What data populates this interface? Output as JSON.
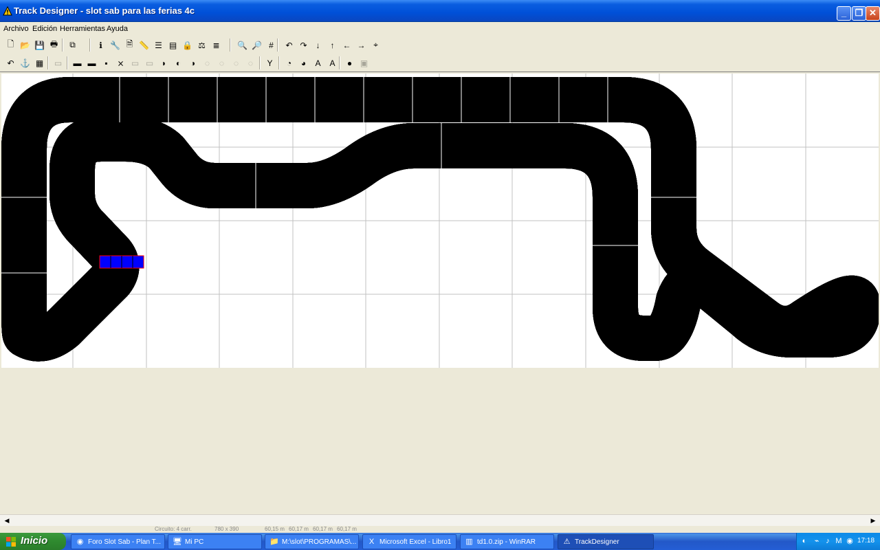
{
  "window": {
    "title": "Track Designer - slot sab para las ferias 4c",
    "minimize": "_",
    "maximize": "❐",
    "close": "✕"
  },
  "menu": [
    "Archivo",
    "Edición",
    "Herramientas",
    "Ayuda"
  ],
  "toolbar1": [
    {
      "name": "new-icon",
      "glyph": "🗋"
    },
    {
      "name": "open-icon",
      "glyph": "📂"
    },
    {
      "name": "save-icon",
      "glyph": "💾"
    },
    {
      "name": "print-icon",
      "glyph": "🖶"
    },
    {
      "name": "copy-icon",
      "glyph": "⧉"
    },
    {
      "name": "info-icon",
      "glyph": "ℹ"
    },
    {
      "name": "wrench-icon",
      "glyph": "🔧"
    },
    {
      "name": "document-icon",
      "glyph": "🗎"
    },
    {
      "name": "ruler-icon",
      "glyph": "📏"
    },
    {
      "name": "stack-icon",
      "glyph": "☰"
    },
    {
      "name": "layers-icon",
      "glyph": "▤"
    },
    {
      "name": "lock-icon",
      "glyph": "🔒"
    },
    {
      "name": "balance-icon",
      "glyph": "⚖"
    },
    {
      "name": "track-list-icon",
      "glyph": "≣"
    },
    {
      "name": "zoom-out-icon",
      "glyph": "🔍"
    },
    {
      "name": "zoom-in-icon",
      "glyph": "🔎"
    },
    {
      "name": "grid-icon",
      "glyph": "#"
    },
    {
      "name": "rotate-left-icon",
      "glyph": "↶"
    },
    {
      "name": "rotate-right-icon",
      "glyph": "↷"
    },
    {
      "name": "arrow-down-icon",
      "glyph": "↓"
    },
    {
      "name": "arrow-up-icon",
      "glyph": "↑"
    },
    {
      "name": "arrow-left-icon",
      "glyph": "←"
    },
    {
      "name": "arrow-right-icon",
      "glyph": "→"
    },
    {
      "name": "center-icon",
      "glyph": "⌖"
    }
  ],
  "toolbar2": [
    {
      "name": "undo-icon",
      "glyph": "↶",
      "enabled": true
    },
    {
      "name": "anchor-icon",
      "glyph": "⚓",
      "enabled": true
    },
    {
      "name": "track-piece-icon",
      "glyph": "▦",
      "enabled": true
    },
    {
      "name": "track-piece-disabled-icon",
      "glyph": "▭",
      "enabled": false
    },
    {
      "name": "straight-long-icon",
      "glyph": "▬",
      "enabled": true
    },
    {
      "name": "straight-medium-icon",
      "glyph": "▬",
      "enabled": true
    },
    {
      "name": "straight-short-icon",
      "glyph": "▪",
      "enabled": true
    },
    {
      "name": "crossover-icon",
      "glyph": "⨯",
      "enabled": true
    },
    {
      "name": "straight-disabled-icon",
      "glyph": "▭",
      "enabled": false
    },
    {
      "name": "straight-disabled-2-icon",
      "glyph": "▭",
      "enabled": false
    },
    {
      "name": "curve-small-icon",
      "glyph": "◗",
      "enabled": true
    },
    {
      "name": "curve-medium-icon",
      "glyph": "◐",
      "enabled": true
    },
    {
      "name": "curve-large-icon",
      "glyph": "◑",
      "enabled": true
    },
    {
      "name": "curve-disabled-icon",
      "glyph": "◌",
      "enabled": false
    },
    {
      "name": "curve-disabled-2-icon",
      "glyph": "◌",
      "enabled": false
    },
    {
      "name": "hairpin-disabled-icon",
      "glyph": "◌",
      "enabled": false
    },
    {
      "name": "loop-disabled-icon",
      "glyph": "◌",
      "enabled": false
    },
    {
      "name": "junction-icon",
      "glyph": "Y",
      "enabled": true
    },
    {
      "name": "border-icon",
      "glyph": "◔",
      "enabled": true
    },
    {
      "name": "border-curve-icon",
      "glyph": "◕",
      "enabled": true
    },
    {
      "name": "auto-icon",
      "glyph": "A",
      "enabled": true
    },
    {
      "name": "auto-remove-icon",
      "glyph": "A",
      "enabled": true
    },
    {
      "name": "color-icon",
      "glyph": "●",
      "enabled": true
    },
    {
      "name": "settings-disabled-icon",
      "glyph": "▣",
      "enabled": false
    }
  ],
  "status": [
    "Circuito: 4 carr.",
    "780 x 390",
    "60,15 m",
    "60,17 m",
    "60,17 m",
    "60,17 m"
  ],
  "taskbar": {
    "start_label": "Inicio",
    "tasks": [
      {
        "label": "Foro Slot Sab - Plan T...",
        "icon": "chrome-icon",
        "glyph": "◉"
      },
      {
        "label": "Mi PC",
        "icon": "computer-icon",
        "glyph": "🖥"
      },
      {
        "label": "M:\\slot\\PROGRAMAS\\...",
        "icon": "folder-icon",
        "glyph": "📁"
      },
      {
        "label": "Microsoft Excel - Libro1",
        "icon": "excel-icon",
        "glyph": "X"
      },
      {
        "label": "td1.0.zip - WinRAR",
        "icon": "winrar-icon",
        "glyph": "▥"
      },
      {
        "label": "TrackDesigner",
        "icon": "warning-icon",
        "glyph": "⚠"
      }
    ],
    "clock": "17:18"
  }
}
